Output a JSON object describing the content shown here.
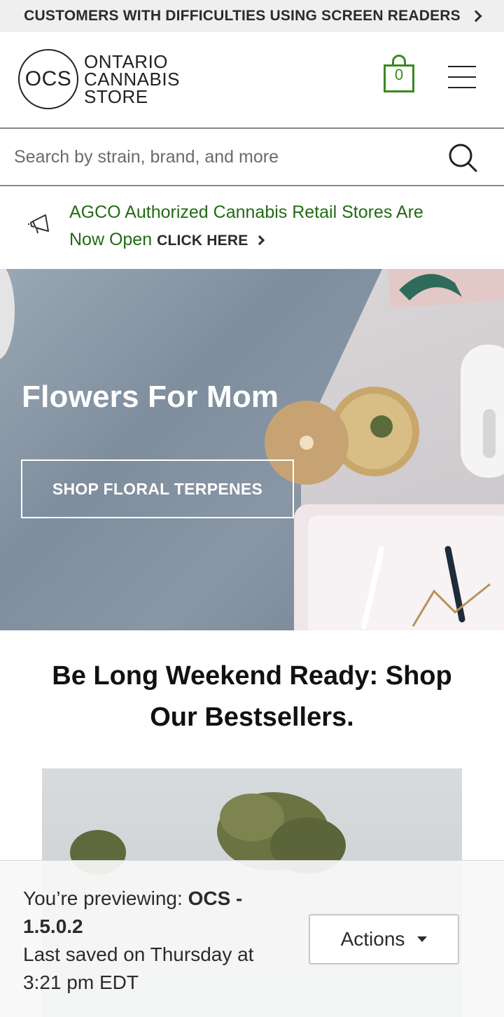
{
  "a11y_bar": {
    "label": "CUSTOMERS WITH DIFFICULTIES USING SCREEN READERS"
  },
  "header": {
    "logo_mark": "OCS",
    "logo_line1": "ONTARIO",
    "logo_line2": "CANNABIS",
    "logo_line3": "STORE",
    "cart_count": "0"
  },
  "search": {
    "placeholder": "Search by strain, brand, and more"
  },
  "announcement": {
    "text": "AGCO Authorized Cannabis Retail Stores Are Now Open",
    "cta": "CLICK HERE"
  },
  "hero": {
    "title": "Flowers For Mom",
    "button_label": "SHOP FLORAL TERPENES"
  },
  "section": {
    "title": "Be Long Weekend Ready: Shop Our Bestsellers."
  },
  "preview": {
    "prefix": "You’re previewing: ",
    "theme": "OCS - 1.5.0.2",
    "saved": "Last saved on Thursday at 3:21 pm EDT",
    "actions_label": "Actions"
  },
  "colors": {
    "brand_green": "#3a8a1f",
    "announce_green": "#216b14"
  }
}
